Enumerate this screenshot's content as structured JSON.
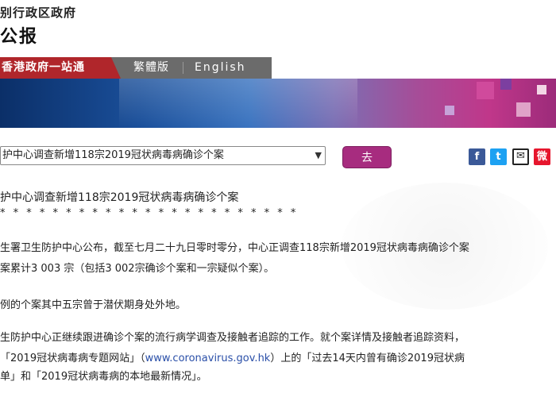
{
  "masthead": {
    "org_name": "别行政区政府",
    "gazette_title": "公报"
  },
  "nav": {
    "portal": "香港政府一站通",
    "traditional": "繁體版",
    "english": "English"
  },
  "toolbar": {
    "select_value": "护中心调查新增118宗2019冠状病毒病确诊个案",
    "go_label": "去",
    "share": {
      "facebook": "f",
      "twitter": "t",
      "email": "✉",
      "weibo": "微"
    }
  },
  "article": {
    "headline": "护中心调查新增118宗2019冠状病毒病确诊个案",
    "stars": "* * * * * * * * * * * * * * * * * * * * * * *",
    "p1_line1": "生署卫生防护中心公布，截至七月二十九日零时零分，中心正调查118宗新增2019冠状病毒病确诊个案",
    "p1_line2": "案累计3 003 宗（包括3 002宗确诊个案和一宗疑似个案）。",
    "p2": "例的个案其中五宗曾于潜伏期身处外地。",
    "p3_line1": "生防护中心正继续跟进确诊个案的流行病学调查及接触者追踪的工作。就个案详情及接触者追踪资料，",
    "p3_line2_prefix": "「2019冠状病毒病专题网站」（",
    "p3_link": "www.coronavirus.gov.hk",
    "p3_line2_suffix": "）上的「过去14天内曾有确诊2019冠状病",
    "p3_line3": "单」和「2019冠状病毒病的本地最新情况」。"
  }
}
